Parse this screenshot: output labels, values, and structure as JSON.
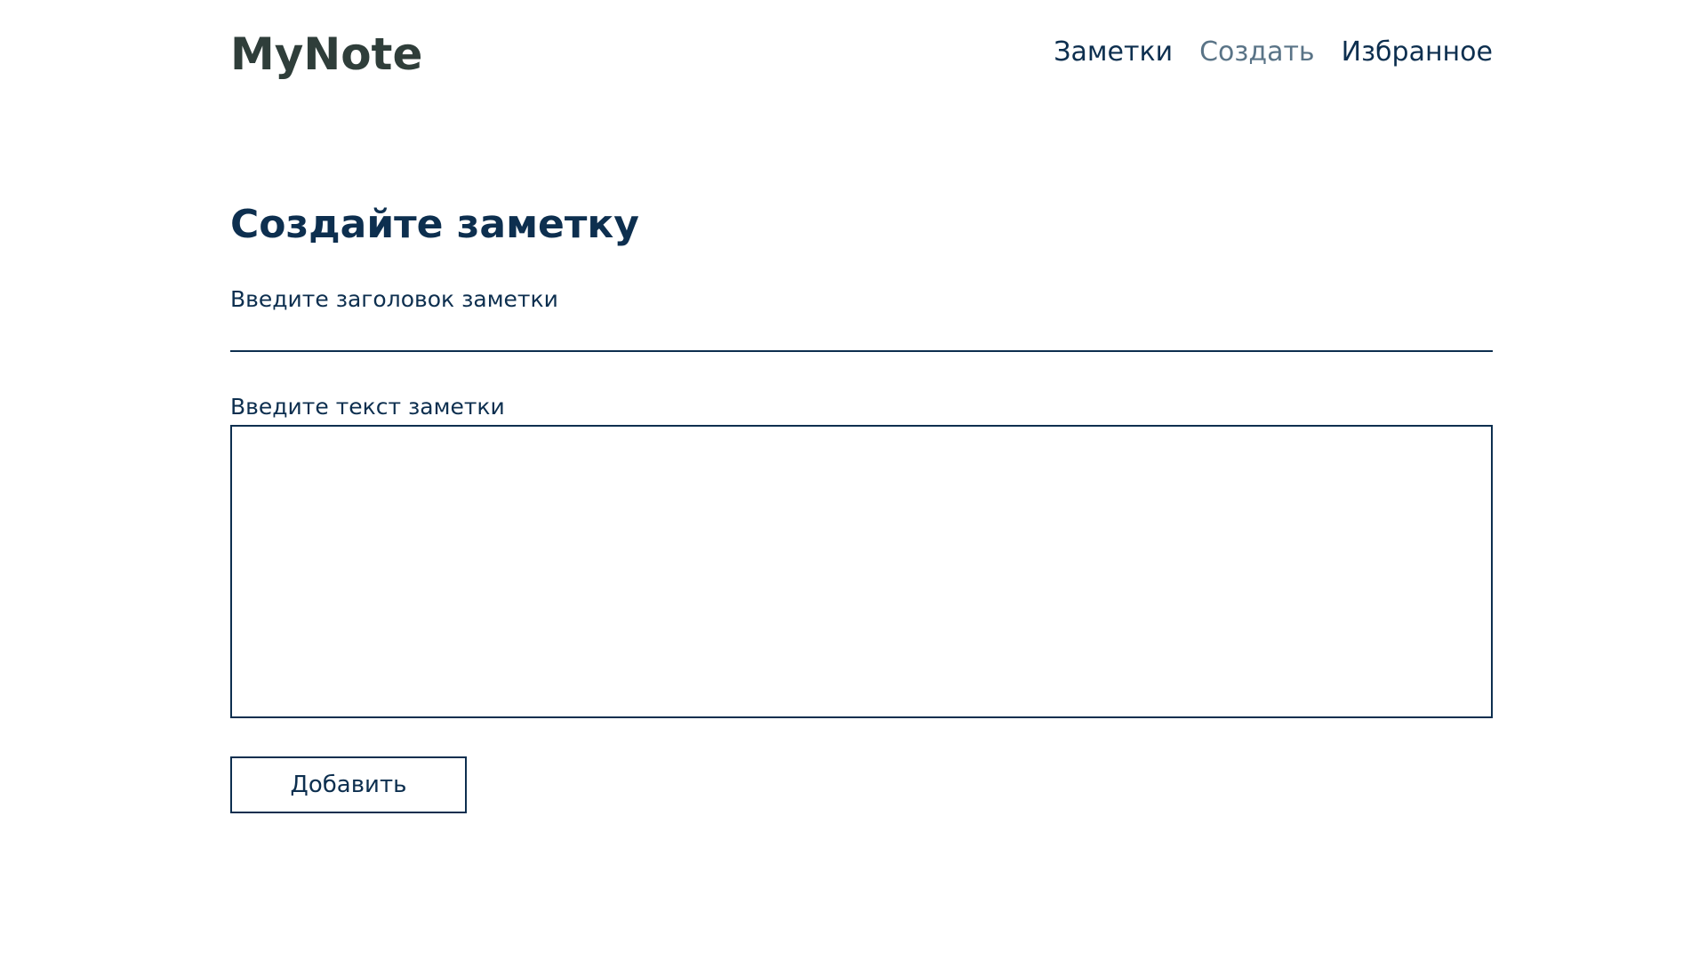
{
  "header": {
    "logo": "MyNote",
    "nav": [
      {
        "label": "Заметки",
        "active": false
      },
      {
        "label": "Создать",
        "active": true
      },
      {
        "label": "Избранное",
        "active": false
      }
    ]
  },
  "main": {
    "title": "Создайте заметку",
    "note_title_label": "Введите заголовок заметки",
    "note_title_value": "",
    "note_text_label": "Введите текст заметки",
    "note_text_value": "",
    "add_button_label": "Добавить"
  },
  "colors": {
    "primary": "#0d2f4f",
    "logo": "#2f3e3a",
    "nav_active": "#5a7487",
    "background": "#ffffff"
  }
}
